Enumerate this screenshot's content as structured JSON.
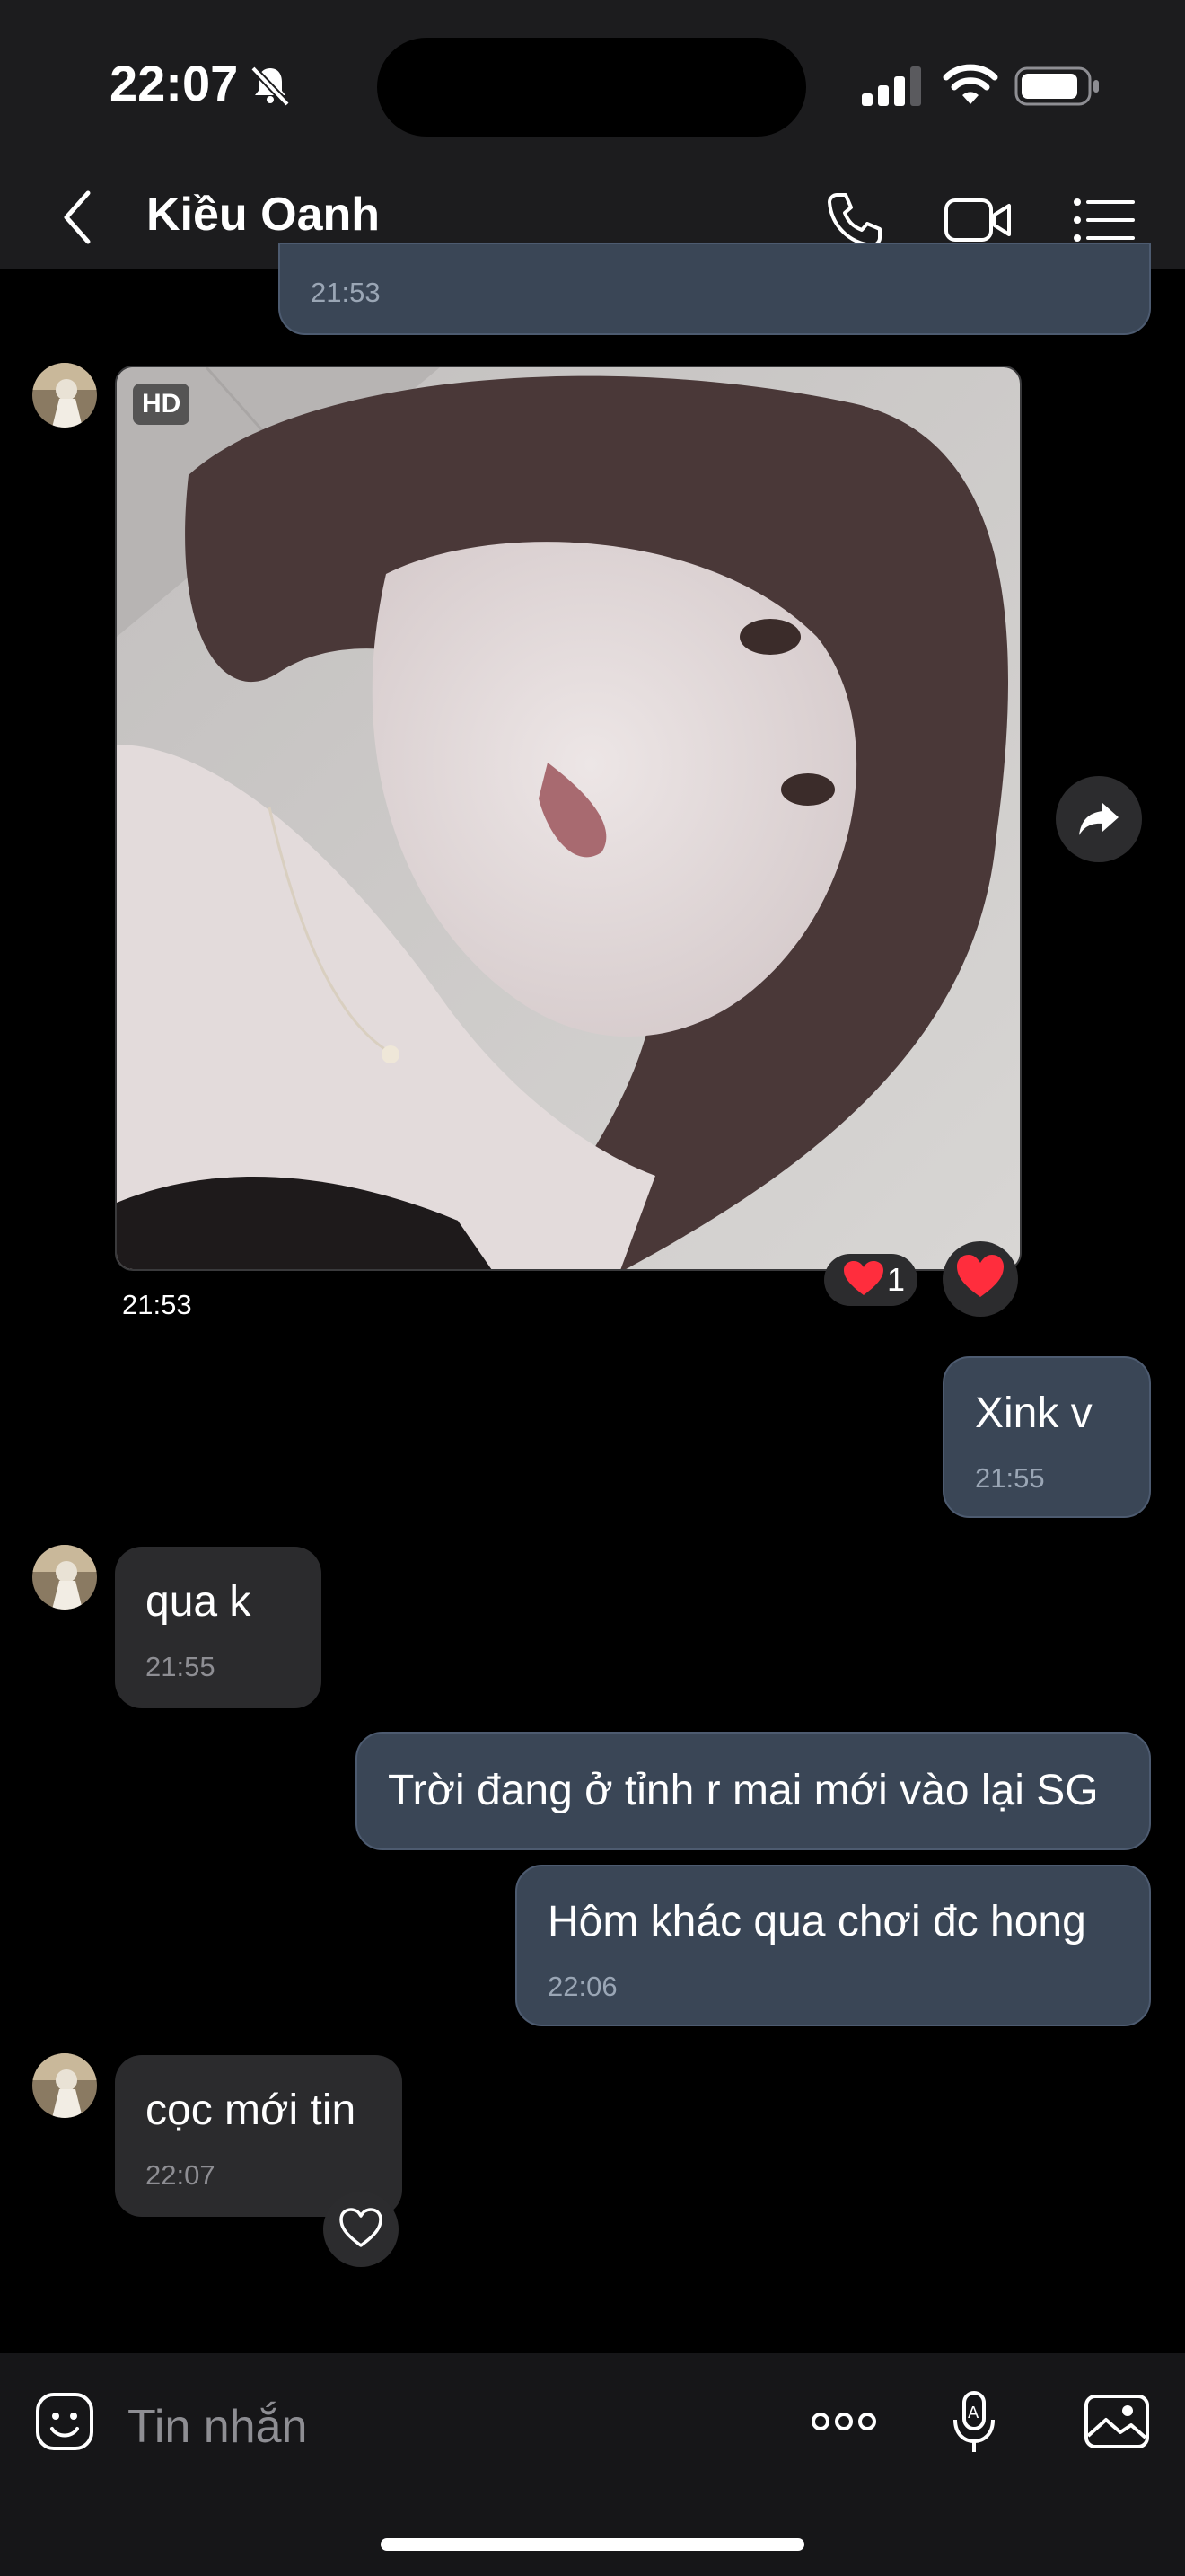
{
  "status_bar": {
    "time": "22:07"
  },
  "header": {
    "contact_name": "Kiều Oanh"
  },
  "messages": [
    {
      "id": "m0",
      "direction": "outgoing",
      "timestamp": "21:53"
    },
    {
      "id": "m1",
      "direction": "incoming",
      "type": "photo",
      "badge": "HD",
      "timestamp": "21:53",
      "reaction_count": "1"
    },
    {
      "id": "m2",
      "direction": "outgoing",
      "text": "Xink v",
      "timestamp": "21:55"
    },
    {
      "id": "m3",
      "direction": "incoming",
      "text": "qua k",
      "timestamp": "21:55"
    },
    {
      "id": "m4",
      "direction": "outgoing",
      "text": "Trời đang ở tỉnh r mai mới vào lại SG"
    },
    {
      "id": "m5",
      "direction": "outgoing",
      "text": "Hôm khác qua chơi đc hong",
      "timestamp": "22:06"
    },
    {
      "id": "m6",
      "direction": "incoming",
      "text": "cọc mới tin",
      "timestamp": "22:07"
    }
  ],
  "composer": {
    "placeholder": "Tin nhắn"
  },
  "colors": {
    "outgoing_bubble": "#3a4656",
    "incoming_bubble": "#2b2b2d",
    "reaction_heart": "#ff2d3d"
  }
}
